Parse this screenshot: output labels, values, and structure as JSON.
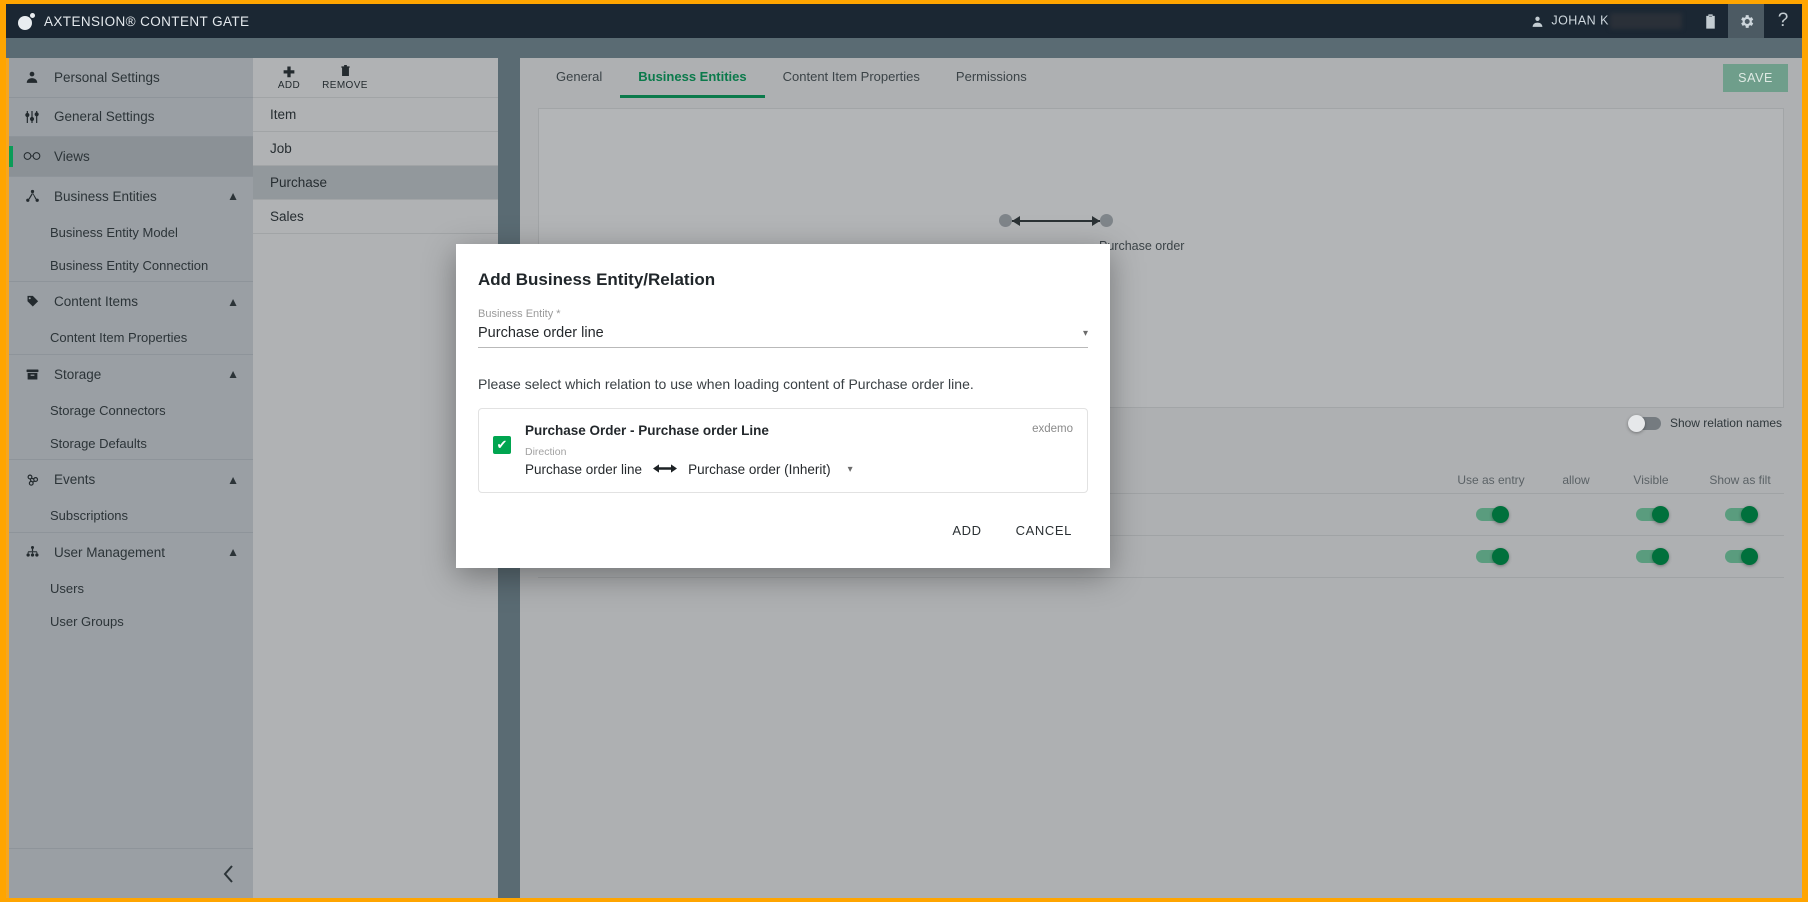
{
  "topbar": {
    "brand": "AXTENSION® CONTENT GATE",
    "user_name": "JOHAN K",
    "icons": {
      "user": "user-icon",
      "clipboard": "clipboard-icon",
      "gear": "gear-icon",
      "help": "?"
    }
  },
  "sidebar": {
    "items": [
      {
        "label": "Personal Settings",
        "icon": "person-icon",
        "type": "top",
        "active": false
      },
      {
        "label": "General Settings",
        "icon": "sliders-icon",
        "type": "top",
        "active": false
      },
      {
        "label": "Views",
        "icon": "glasses-icon",
        "type": "top",
        "active": true
      },
      {
        "label": "Business Entities",
        "icon": "hierarchy-icon",
        "type": "group",
        "active": false,
        "chevron": "chevron-up"
      },
      {
        "label": "Business Entity Model",
        "type": "sub",
        "active": false
      },
      {
        "label": "Business Entity Connection",
        "type": "sub",
        "active": false
      },
      {
        "label": "Content Items",
        "icon": "tag-icon",
        "type": "group",
        "active": false,
        "chevron": "chevron-up"
      },
      {
        "label": "Content Item Properties",
        "type": "sub",
        "active": false
      },
      {
        "label": "Storage",
        "icon": "archive-icon",
        "type": "group",
        "active": false,
        "chevron": "chevron-up"
      },
      {
        "label": "Storage Connectors",
        "type": "sub",
        "active": false
      },
      {
        "label": "Storage Defaults",
        "type": "sub",
        "active": false
      },
      {
        "label": "Events",
        "icon": "webhook-icon",
        "type": "group",
        "active": false,
        "chevron": "chevron-up"
      },
      {
        "label": "Subscriptions",
        "type": "sub",
        "active": false
      },
      {
        "label": "User Management",
        "icon": "org-icon",
        "type": "group",
        "active": false,
        "chevron": "chevron-up"
      },
      {
        "label": "Users",
        "type": "sub",
        "active": false
      },
      {
        "label": "User Groups",
        "type": "sub",
        "active": false
      }
    ],
    "collapse_glyph": "‹"
  },
  "entity_panel": {
    "toolbar": [
      {
        "label": "ADD",
        "glyph": "➕",
        "icon": "plus-icon"
      },
      {
        "label": "REMOVE",
        "glyph": "🗑",
        "icon": "trash-icon"
      }
    ],
    "rows": [
      {
        "label": "Item",
        "selected": false
      },
      {
        "label": "Job",
        "selected": false
      },
      {
        "label": "Purchase",
        "selected": true
      },
      {
        "label": "Sales",
        "selected": false
      }
    ]
  },
  "main": {
    "tabs": [
      {
        "label": "General",
        "active": false
      },
      {
        "label": "Business Entities",
        "active": true
      },
      {
        "label": "Content Item Properties",
        "active": false
      },
      {
        "label": "Permissions",
        "active": false
      }
    ],
    "save_label": "SAVE",
    "diagram_label": "Purchase order",
    "show_relation_names": {
      "label": "Show relation names",
      "on": false
    },
    "grid_headers": [
      "Use as entry",
      "allow",
      "Visible",
      "Show as filt"
    ],
    "grid_rows": [
      {
        "toggles": [
          true,
          true,
          true
        ]
      },
      {
        "toggles": [
          true,
          true,
          true
        ]
      }
    ]
  },
  "modal": {
    "title": "Add Business Entity/Relation",
    "entity_field": {
      "label": "Business Entity *",
      "value": "Purchase order line",
      "caret": "▾"
    },
    "hint": "Please select which relation to use when loading content of Purchase order line.",
    "relation": {
      "checked": true,
      "check_glyph": "✔",
      "name": "Purchase Order - Purchase order Line",
      "tag": "exdemo",
      "direction_label": "Direction",
      "direction_from": "Purchase order line",
      "direction_arrow": "⟷",
      "direction_to": "Purchase order (Inherit)",
      "direction_caret": "▾"
    },
    "actions": [
      {
        "label": "ADD",
        "name": "add-button"
      },
      {
        "label": "CANCEL",
        "name": "cancel-button"
      }
    ]
  },
  "colors": {
    "brand_orange": "#f5a623",
    "accent_green": "#0b7a4b",
    "toggle_on": "#00703c",
    "topbar_bg": "#1b2733"
  }
}
